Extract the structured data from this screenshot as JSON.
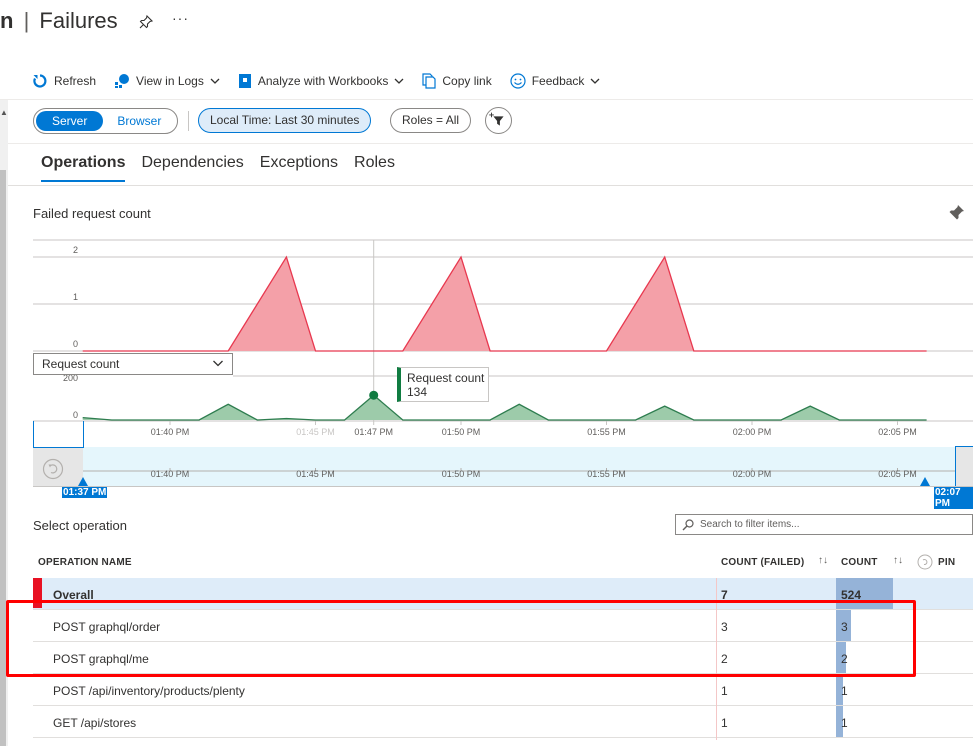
{
  "header": {
    "title_prefix": "n",
    "title_separator": "|",
    "title": "Failures",
    "pin_icon": "pin-outline-icon",
    "more_label": "···"
  },
  "toolbar": {
    "refresh": "Refresh",
    "view_in_logs": "View in Logs",
    "analyze_workbooks": "Analyze with Workbooks",
    "copy_link": "Copy link",
    "feedback": "Feedback"
  },
  "filters": {
    "server": "Server",
    "browser": "Browser",
    "active_segment": "Server",
    "time_range": "Local Time: Last 30 minutes",
    "roles": "Roles = All",
    "add_filter_icon": "add-filter-icon"
  },
  "tabs": [
    {
      "label": "Operations",
      "active": true
    },
    {
      "label": "Dependencies",
      "active": false
    },
    {
      "label": "Exceptions",
      "active": false
    },
    {
      "label": "Roles",
      "active": false
    }
  ],
  "chart_section": {
    "title": "Failed request count",
    "metric_select": "Request count",
    "tooltip_label": "Request count",
    "tooltip_value": "134",
    "brush_start": "01:37 PM",
    "brush_end": "02:07 PM"
  },
  "chart_data": [
    {
      "type": "area",
      "title": "Failed request count",
      "series": [
        {
          "name": "Failed request count",
          "color": "#e8384f",
          "points": [
            [
              "01:37",
              0
            ],
            [
              "01:42",
              0
            ],
            [
              "01:44",
              2
            ],
            [
              "01:45",
              0
            ],
            [
              "01:47",
              0
            ],
            [
              "01:48",
              0
            ],
            [
              "01:50",
              2
            ],
            [
              "01:51",
              0
            ],
            [
              "01:55",
              0
            ],
            [
              "01:57",
              2
            ],
            [
              "01:58",
              0
            ],
            [
              "02:06",
              0
            ]
          ]
        }
      ],
      "yticks": [
        0,
        1,
        2
      ],
      "ylim": [
        0,
        2
      ],
      "grid": true
    },
    {
      "type": "area",
      "title": "Request count",
      "series": [
        {
          "name": "Request count",
          "color": "#107c41",
          "points": [
            [
              "01:37",
              13
            ],
            [
              "01:38",
              0
            ],
            [
              "01:39",
              0
            ],
            [
              "01:40",
              0
            ],
            [
              "01:41",
              0
            ],
            [
              "01:42",
              85
            ],
            [
              "01:43",
              0
            ],
            [
              "01:44",
              8
            ],
            [
              "01:45",
              0
            ],
            [
              "01:46",
              0
            ],
            [
              "01:47",
              134
            ],
            [
              "01:48",
              0
            ],
            [
              "01:49",
              0
            ],
            [
              "01:50",
              0
            ],
            [
              "01:51",
              0
            ],
            [
              "01:52",
              85
            ],
            [
              "01:53",
              0
            ],
            [
              "01:54",
              0
            ],
            [
              "01:55",
              0
            ],
            [
              "01:56",
              0
            ],
            [
              "01:57",
              75
            ],
            [
              "01:58",
              0
            ],
            [
              "01:59",
              0
            ],
            [
              "02:00",
              0
            ],
            [
              "02:01",
              0
            ],
            [
              "02:02",
              75
            ],
            [
              "02:03",
              0
            ],
            [
              "02:04",
              0
            ],
            [
              "02:05",
              0
            ],
            [
              "02:06",
              0
            ]
          ]
        }
      ],
      "highlight": {
        "x": "01:47",
        "value": 134
      },
      "yticks": [
        0,
        200
      ],
      "xticks": [
        "01:40 PM",
        "01:45 PM",
        "01:47 PM",
        "01:50 PM",
        "01:55 PM",
        "02:00 PM",
        "02:05 PM"
      ],
      "grid": true
    },
    {
      "type": "area",
      "title": "Time brush",
      "xticks": [
        "01:40 PM",
        "01:45 PM",
        "01:50 PM",
        "01:55 PM",
        "02:00 PM",
        "02:05 PM"
      ],
      "range": [
        "01:37 PM",
        "02:07 PM"
      ]
    }
  ],
  "operations": {
    "title": "Select operation",
    "search_placeholder": "Search to filter items...",
    "columns": {
      "name": "OPERATION NAME",
      "failed": "COUNT (FAILED)",
      "count": "COUNT",
      "pin": "PIN",
      "sort_glyph": "↑↓"
    },
    "max_count": 524,
    "rows": [
      {
        "name": "Overall",
        "failed": "7",
        "count": "524",
        "count_fraction": 1.0,
        "selected": true
      },
      {
        "name": "POST graphql/order",
        "failed": "3",
        "count": "3",
        "count_fraction": 0.26
      },
      {
        "name": "POST graphql/me",
        "failed": "2",
        "count": "2",
        "count_fraction": 0.17
      },
      {
        "name": "POST /api/inventory/products/plenty",
        "failed": "1",
        "count": "1",
        "count_fraction": 0.08
      },
      {
        "name": "GET /api/stores",
        "failed": "1",
        "count": "1",
        "count_fraction": 0.08
      }
    ]
  }
}
